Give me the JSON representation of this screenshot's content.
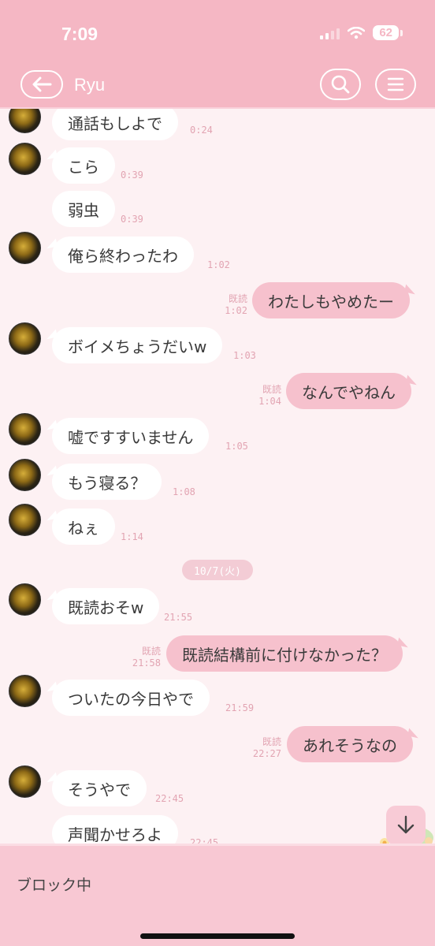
{
  "status": {
    "time": "7:09",
    "battery": "62"
  },
  "header": {
    "title": "Ryu"
  },
  "messages": [
    {
      "dir": "in",
      "text": "通話もしよで",
      "time": "0:24"
    },
    {
      "dir": "in",
      "text": "こら",
      "time": "0:39"
    },
    {
      "dir": "in",
      "text": "弱虫",
      "time": "0:39"
    },
    {
      "dir": "in",
      "text": "俺ら終わったわ",
      "time": "1:02"
    },
    {
      "dir": "out",
      "text": "わたしもやめたー",
      "read": "既読",
      "time": "1:02"
    },
    {
      "dir": "in",
      "text": "ボイメちょうだいw",
      "time": "1:03"
    },
    {
      "dir": "out",
      "text": "なんでやねん",
      "read": "既読",
      "time": "1:04"
    },
    {
      "dir": "in",
      "text": "嘘ですすいません",
      "time": "1:05"
    },
    {
      "dir": "in",
      "text": "もう寝る？",
      "time": "1:08"
    },
    {
      "dir": "in",
      "text": "ねぇ",
      "time": "1:14"
    },
    {
      "dir": "in",
      "text": "既読おそw",
      "time": "21:55"
    },
    {
      "dir": "out",
      "text": "既読結構前に付けなかった？",
      "read": "既読",
      "time": "21:58"
    },
    {
      "dir": "in",
      "text": "ついたの今日やで",
      "time": "21:59"
    },
    {
      "dir": "out",
      "text": "あれそうなの",
      "read": "既読",
      "time": "22:27"
    },
    {
      "dir": "in",
      "text": "そうやで",
      "time": "22:45"
    },
    {
      "dir": "in",
      "text": "声聞かせろよ",
      "time": "22:45"
    }
  ],
  "date_separator": "10/7(火)",
  "bottom": {
    "status_text": "ブロック中"
  },
  "icons": {
    "back": "back-arrow-icon",
    "search": "search-icon",
    "menu": "hamburger-menu-icon",
    "scroll": "arrow-down-icon"
  },
  "colors": {
    "header_bg": "#f5b7c4",
    "chat_bg": "#fdf1f3",
    "incoming_bubble": "#ffffff",
    "outgoing_bubble": "#f6c1cd",
    "timestamp": "#e2a4b2"
  }
}
